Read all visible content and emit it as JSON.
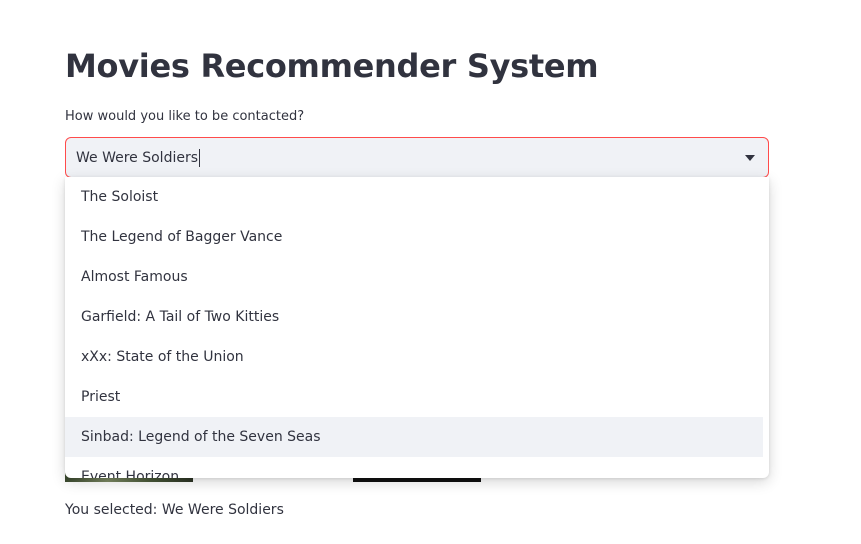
{
  "page": {
    "title": "Movies Recommender System"
  },
  "selectbox": {
    "label": "How would you like to be contacted?",
    "typed_value": "We Were Soldiers",
    "options": [
      "The Soloist",
      "The Legend of Bagger Vance",
      "Almost Famous",
      "Garfield: A Tail of Two Kitties",
      "xXx: State of the Union",
      "Priest",
      "Sinbad: Legend of the Seven Seas",
      "Event Horizon"
    ],
    "highlighted_option": "Sinbad: Legend of the Seven Seas"
  },
  "result": {
    "text": "You selected: We Were Soldiers"
  },
  "colors": {
    "text": "#31333f",
    "input_bg": "#f0f2f6",
    "focus_border": "#ff4b4b",
    "highlight_bg": "#f0f2f6"
  }
}
